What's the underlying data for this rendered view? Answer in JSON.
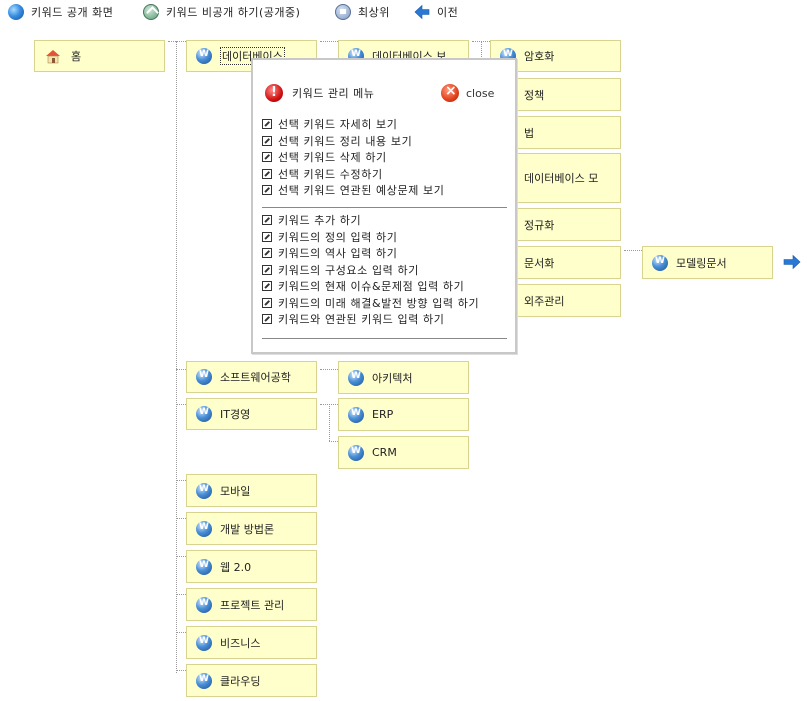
{
  "toolbar": {
    "public_screen": "키워드 공개 화면",
    "private": "키워드 비공개 하기(공개중)",
    "top": "최상위",
    "prev": "이전"
  },
  "tree": {
    "home": "홈",
    "database": "데이터베이스",
    "db_child": "데이터베이스 보",
    "crypto": "암호화",
    "policy": "정책",
    "law": "법",
    "db_model": "데이터베이스 모",
    "normalization": "정규화",
    "documentation": "문서화",
    "modeling_doc": "모델링문서",
    "outsourcing": "외주관리",
    "software_eng": "소프트웨어공학",
    "architecture": "아키텍처",
    "it_management": "IT경영",
    "erp": "ERP",
    "crm": "CRM",
    "mobile": "모바일",
    "dev_method": "개발 방법론",
    "web2": "웹 2.0",
    "project_mgmt": "프로젝트 관리",
    "business": "비즈니스",
    "cloud": "클라우딩"
  },
  "popup": {
    "title": "키워드 관리 메뉴",
    "close": "close",
    "group1": [
      "선택 키워드 자세히 보기",
      "선택 키워드 정리 내용 보기",
      "선택 키워드 삭제 하기",
      "선택 키워드 수정하기",
      "선택 키워드 연관된 예상문제 보기"
    ],
    "group2": [
      "키워드 추가 하기",
      "키워드의 정의 입력 하기",
      "키워드의 역사 입력 하기",
      "키워드의 구성요소 입력 하기",
      "키워드의 현재 이슈&문제점 입력 하기",
      "키워드의 미래 해결&발전 방향 입력 하기",
      "키워드와 연관된 키워드 입력 하기"
    ]
  }
}
